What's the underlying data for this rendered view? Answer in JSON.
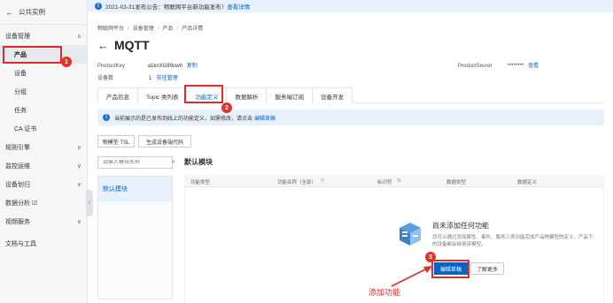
{
  "sidebar": {
    "instance_label": "公共实例",
    "groups": [
      {
        "label": "设备管理",
        "caret": "∧"
      },
      {
        "label": "规则引擎",
        "caret": "∨"
      },
      {
        "label": "监控运维",
        "caret": "∨"
      },
      {
        "label": "设备划归",
        "caret": "∨"
      },
      {
        "label": "数据分析 ☑",
        "caret": ""
      },
      {
        "label": "视频服务",
        "caret": "∨"
      },
      {
        "label": "文档与工具",
        "caret": ""
      }
    ],
    "items": [
      "产品",
      "设备",
      "分组",
      "任务",
      "CA 证书"
    ]
  },
  "notice": {
    "text": "2021-03-31发布公告：物联网平台新功能发布！",
    "link": "查看详情"
  },
  "breadcrumb": [
    "物联网平台",
    "设备管理",
    "产品",
    "产品详情"
  ],
  "title": "MQTT",
  "meta": {
    "product_key_label": "ProductKey",
    "product_key_value": "a1knXG89uwh",
    "product_key_action": "复制",
    "device_count_label": "设备数",
    "device_count_value": "1",
    "device_count_action": "前往管理",
    "product_secret_label": "ProductSecret",
    "product_secret_value": "********",
    "product_secret_action": "查看"
  },
  "tabs": [
    "产品信息",
    "Topic 类列表",
    "功能定义",
    "数据解析",
    "服务端订阅",
    "设备开发"
  ],
  "active_tab": 2,
  "info_bar": {
    "text": "当前展示的是已发布到线上的功能定义，如需修改，请点击",
    "link": "编辑草稿"
  },
  "buttons": {
    "tsl": "物模型 TSL",
    "gen_code": "生成设备端代码"
  },
  "search": {
    "placeholder": "请输入模块名称"
  },
  "modules": [
    "默认模块"
  ],
  "section_title": "默认模块",
  "table_headers": [
    "功能类型",
    "功能名称（全部）",
    "标识符",
    "数据类型",
    "数据定义"
  ],
  "empty": {
    "title": "尚未添加任何功能",
    "desc": "您可以通过添加属性、事件、服务三类功能完成产品物模型的定义，产品下的设备都会继承该模型。",
    "primary": "编辑草稿",
    "secondary": "了解更多"
  },
  "annotations": {
    "badge1": "1",
    "badge2": "2",
    "badge3": "3",
    "add_function": "添加功能"
  },
  "colors": {
    "accent": "#0064c8",
    "annotation": "#e02b2b"
  }
}
